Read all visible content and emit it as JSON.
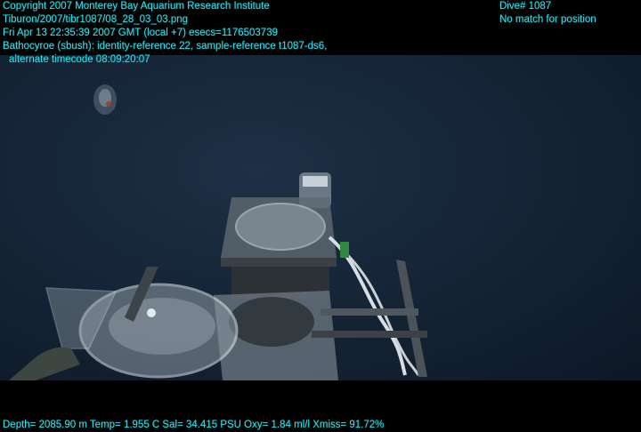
{
  "overlay": {
    "copyright": "Copyright 2007 Monterey Bay Aquarium Research Institute",
    "file_path": "Tiburon/2007/tibr1087/08_28_03_03.png",
    "datetime": "Fri Apr 13 22:35:39 2007 GMT (local +7)  esecs=1176503739",
    "annotation": "Bathocyroe (sbush): identity-reference 22, sample-reference t1087-ds6,",
    "timecode": "alternate timecode 08:09:20:07",
    "dive": "Dive# 1087",
    "position_status": "No match for position",
    "sensors": "Depth= 2085.90 m  Temp= 1.955 C  Sal= 34.415 PSU  Oxy= 1.84 ml/l  Xmiss= 91.72%"
  },
  "colors": {
    "overlay_text": "#22e3ef",
    "water": "#142334"
  }
}
